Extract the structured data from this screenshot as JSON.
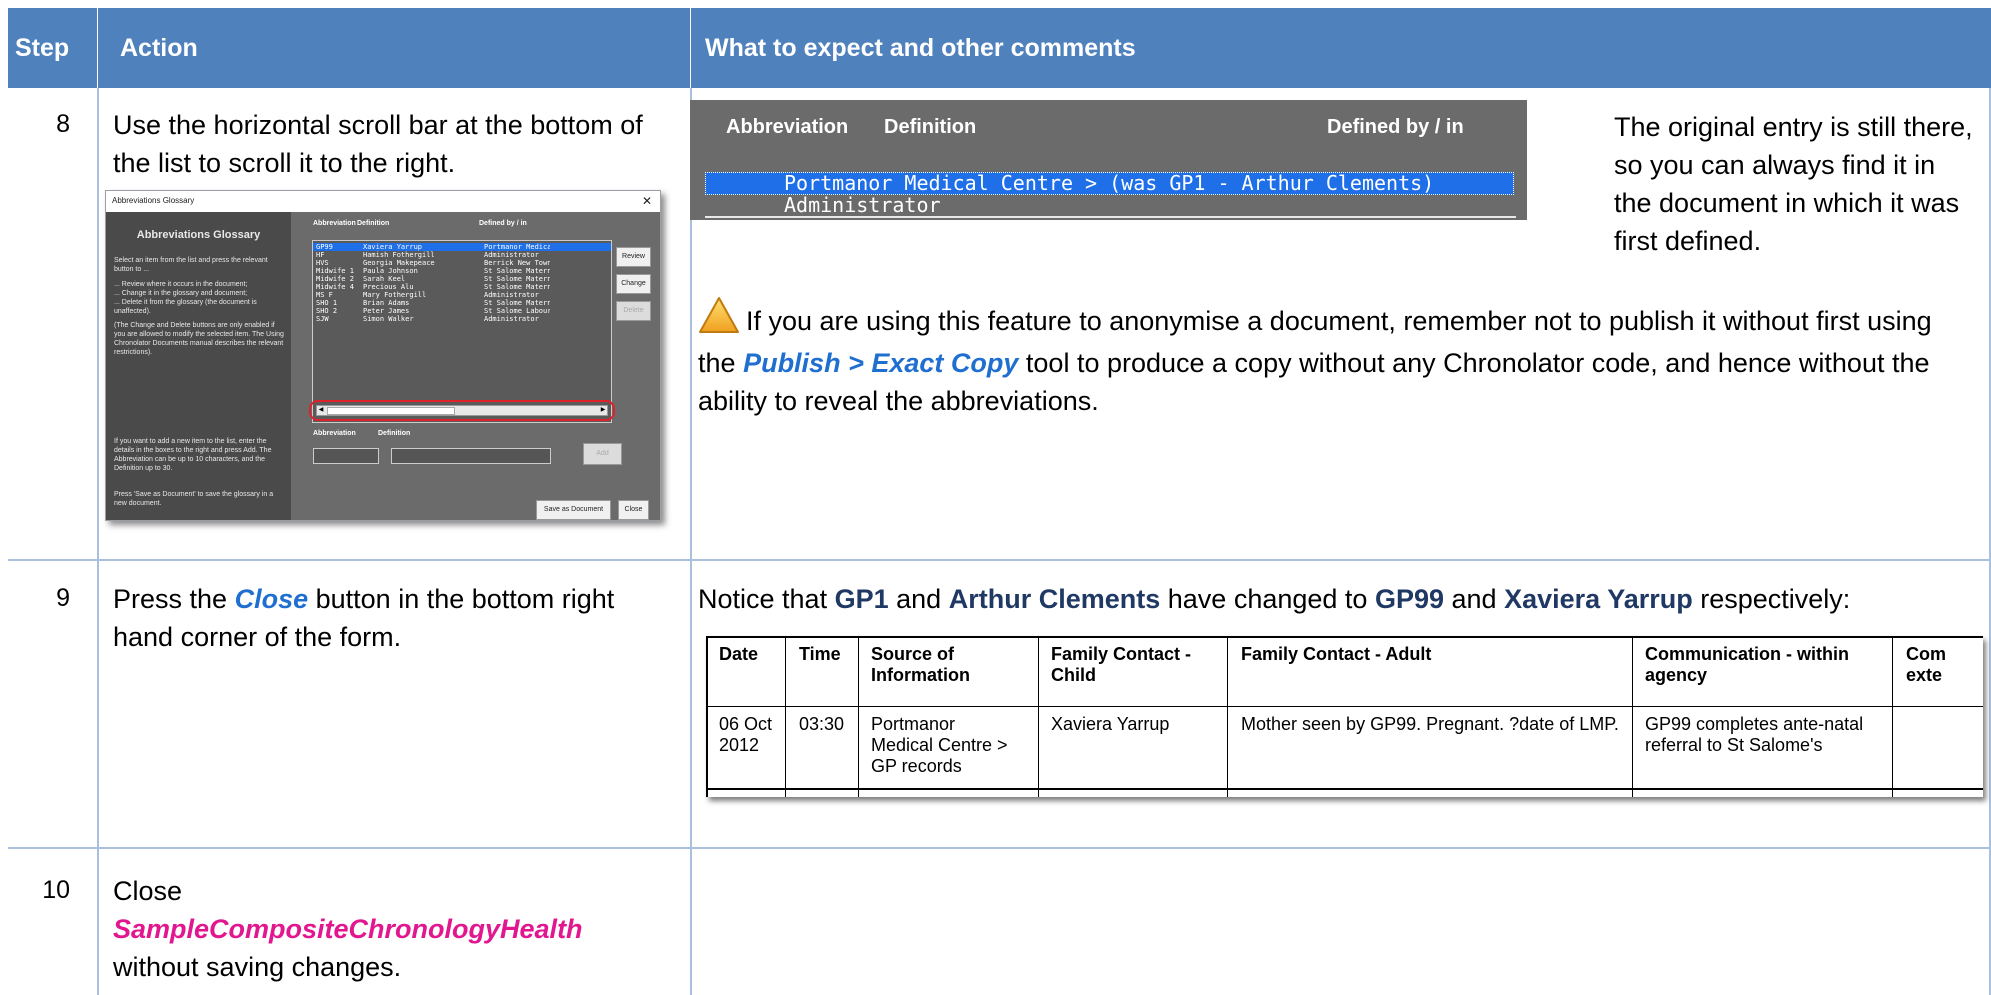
{
  "header": {
    "step": "Step",
    "action": "Action",
    "comments": "What to expect and other comments"
  },
  "rows": [
    {
      "step": "8",
      "action": "Use the horizontal scroll bar at the bottom of the list to scroll it to the right.",
      "strip": {
        "col_abbreviation": "Abbreviation",
        "col_definition": "Definition",
        "col_defined_by": "Defined by / in",
        "selected_line": "Portmanor Medical Centre > (was GP1 - Arthur Clements)",
        "second_line": "Administrator"
      },
      "note": "The original entry is still there, so you can always find it in the document in which it was first defined.",
      "warning_before": "If you are using this feature to anonymise a document, remember not to publish it without first using the",
      "warning_link": "Publish > Exact Copy",
      "warning_after": "tool to produce a copy without any Chronolator code, and hence without the ability to reveal the abbreviations."
    },
    {
      "step": "9",
      "action_before": "Press the",
      "action_link": "Close",
      "action_after": "button in the bottom right hand corner of the form.",
      "notice": {
        "t1": "Notice that",
        "b1": "GP1",
        "t2": "and",
        "b2": "Arthur Clements",
        "t3": "have changed to",
        "b3": "GP99",
        "t4": "and",
        "b4": "Xaviera Yarrup",
        "t5": "respectively:"
      }
    },
    {
      "step": "10",
      "action_before": "Close",
      "action_link": "SampleCompositeChronologyHealth",
      "action_after": "without saving changes."
    }
  ],
  "dialog": {
    "title": "Abbreviations Glossary",
    "heading": "Abbreviations Glossary",
    "intro": "Select an item from the list and press the relevant button to ...",
    "bullets": "... Review where it occurs in the document;\n... Change it in the glossary and document;\n... Delete it from the glossary (the document is unaffected).",
    "permission_note": "(The Change and Delete buttons are only enabled if you are allowed to modify the selected item. The Using Chronolator Documents manual describes the relevant restrictions).",
    "add_note": "If you want to add a new item to the list, enter the details in the boxes to the right and press Add. The Abbreviation can be up to 10 characters, and the Definition up to 30.",
    "save_note": "Press 'Save as Document' to save the glossary in a new document.",
    "col_abbreviation": "Abbreviation",
    "col_definition": "Definition",
    "col_defined_by": "Defined by / in",
    "items": [
      [
        "GP99",
        "Xaviera Yarrup",
        "Portmanor Medica"
      ],
      [
        "HF",
        "Hamish Fothergill",
        "Administrator"
      ],
      [
        "HVS",
        "Georgia Makepeace",
        "Berrick New Town"
      ],
      [
        "Midwife 1",
        "Paula Johnson",
        "St Salome Matern"
      ],
      [
        "Midwife 2",
        "Sarah Keel",
        "St Salome Matern"
      ],
      [
        "Midwife 4",
        "Precious Alu",
        "St Salome Matern"
      ],
      [
        "MS F",
        "Mary Fothergill",
        "Administrator"
      ],
      [
        "SHO 1",
        "Brian Adams",
        "St Salome Matern"
      ],
      [
        "SHO 2",
        "Peter James",
        "St Salome Labour"
      ],
      [
        "SJW",
        "Simon Walker",
        "Administrator"
      ]
    ],
    "buttons": {
      "review": "Review",
      "change": "Change",
      "delete": "Delete",
      "add": "Add",
      "save_as_document": "Save as Document",
      "close": "Close"
    },
    "field_labels": {
      "abbreviation": "Abbreviation",
      "definition": "Definition"
    }
  },
  "chronology": {
    "headers": [
      "Date",
      "Time",
      "Source of Information",
      "Family Contact - Child",
      "Family Contact - Adult",
      "Communication - within agency",
      "Com exte"
    ],
    "row": [
      "06 Oct 2012",
      "03:30",
      "Portmanor Medical Centre > GP records",
      "Xaviera Yarrup",
      "Mother seen by GP99. Pregnant. ?date of LMP.",
      "GP99 completes ante-natal referral to St Salome's",
      ""
    ]
  },
  "colors": {
    "header_bg": "#4f81bd",
    "grid_line": "#a9c0de",
    "link_blue": "#1f6fd1",
    "magenta": "#e2168f",
    "navy": "#1f3864",
    "dialog_dark": "#4a4a4a",
    "dialog_mid": "#6b6b6b",
    "selection": "#1e6fe8",
    "highlight_ring": "#e0202a"
  },
  "icons": [
    "warning-icon",
    "close-icon",
    "scroll-left-icon",
    "scroll-right-icon"
  ]
}
